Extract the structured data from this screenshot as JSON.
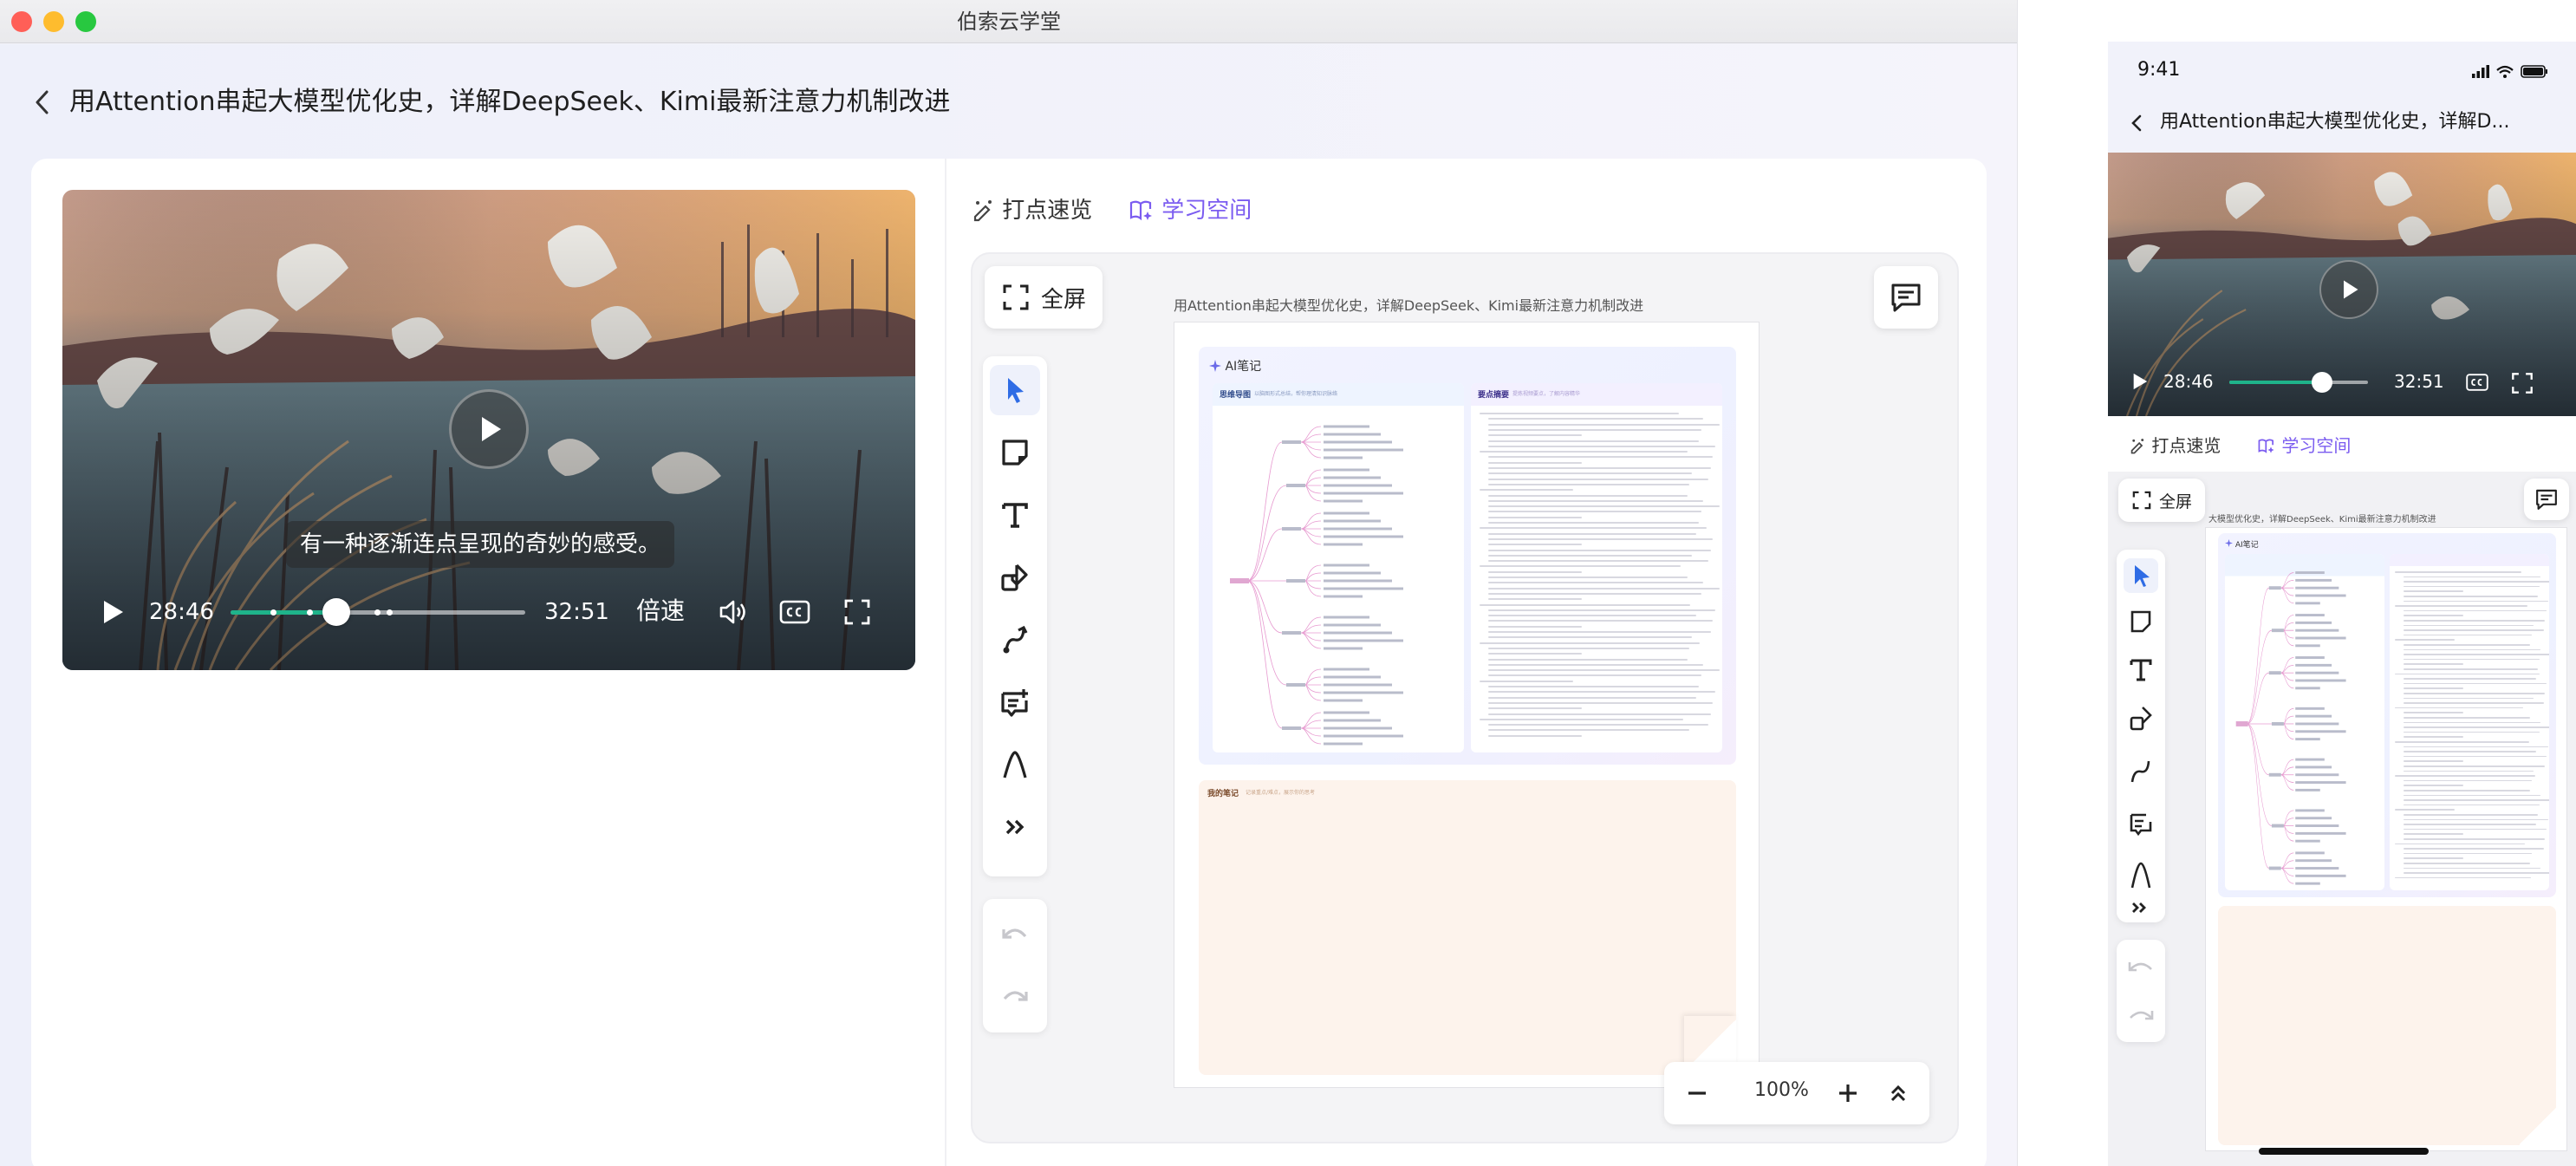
{
  "window": {
    "title": "伯索云学堂",
    "traffic_lights": {
      "close": "#ff5f57",
      "minimize": "#febc2e",
      "zoom": "#28c840"
    }
  },
  "page": {
    "title": "用Attention串起大模型优化史，详解DeepSeek、Kimi最新注意力机制改进"
  },
  "video": {
    "subtitle": "有一种逐渐连点呈现的奇妙的感受。",
    "current_time": "28:46",
    "duration": "32:51",
    "progress": 0.36,
    "speed_label": "倍速",
    "accent": "#1fb38a"
  },
  "tabs": [
    {
      "label": "打点速览",
      "icon": "pen-dots-icon",
      "active": false
    },
    {
      "label": "学习空间",
      "icon": "book-star-icon",
      "active": true
    }
  ],
  "accent_purple": "#7b5cf0",
  "whiteboard": {
    "fullscreen_label": "全屏",
    "doc_title": "用Attention串起大模型优化史，详解DeepSeek、Kimi最新注意力机制改进",
    "ai_note_label": "AI笔记",
    "mindmap_label": "思维导图",
    "mindmap_sub": "以脑图形式总结，帮你理清知识脉络",
    "summary_label": "要点摘要",
    "summary_sub": "提炼视频要点，了解内容精华",
    "my_notes_label": "我的笔记",
    "my_notes_sub": "记录重点/难点，展示你的思考",
    "zoom": "100%",
    "tools": [
      "select-icon",
      "sticky-note-icon",
      "text-icon",
      "shapes-icon",
      "connector-icon",
      "comment-add-icon",
      "pen-icon",
      "more-icon"
    ]
  },
  "phone": {
    "time": "9:41",
    "title": "用Attention串起大模型优化史，详解D...",
    "current_time": "28:46",
    "duration": "32:51",
    "progress": 0.67,
    "doc_title_partial": "大模型优化史，详解DeepSeek、Kimi最新注意力机制改进"
  }
}
